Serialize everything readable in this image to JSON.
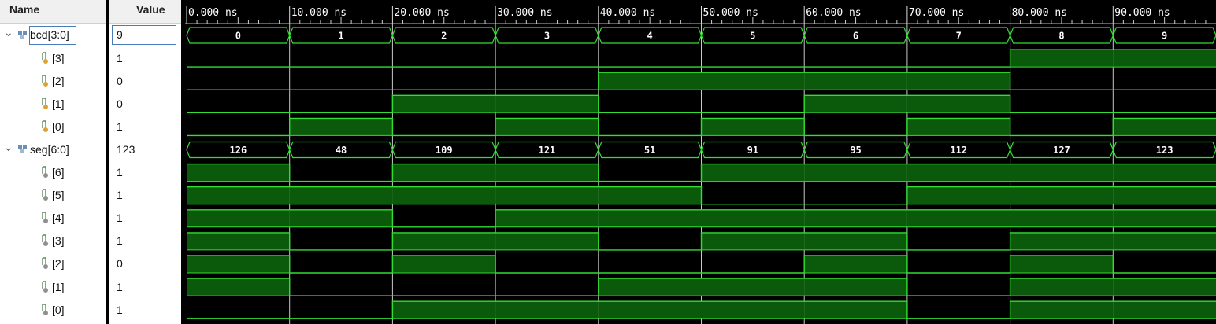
{
  "columns": {
    "name": "Name",
    "value": "Value"
  },
  "signals": [
    {
      "name": "bcd[3:0]",
      "value": "9",
      "kind": "bus",
      "expanded": true,
      "selected": true,
      "segments": [
        "0",
        "1",
        "2",
        "3",
        "4",
        "5",
        "6",
        "7",
        "8",
        "9"
      ]
    },
    {
      "name": "[3]",
      "value": "1",
      "kind": "bit",
      "color": "orange",
      "levels": [
        0,
        0,
        0,
        0,
        0,
        0,
        0,
        0,
        1,
        1
      ]
    },
    {
      "name": "[2]",
      "value": "0",
      "kind": "bit",
      "color": "orange",
      "levels": [
        0,
        0,
        0,
        0,
        1,
        1,
        1,
        1,
        0,
        0
      ]
    },
    {
      "name": "[1]",
      "value": "0",
      "kind": "bit",
      "color": "orange",
      "levels": [
        0,
        0,
        1,
        1,
        0,
        0,
        1,
        1,
        0,
        0
      ]
    },
    {
      "name": "[0]",
      "value": "1",
      "kind": "bit",
      "color": "orange",
      "levels": [
        0,
        1,
        0,
        1,
        0,
        1,
        0,
        1,
        0,
        1
      ]
    },
    {
      "name": "seg[6:0]",
      "value": "123",
      "kind": "bus",
      "expanded": true,
      "selected": false,
      "segments": [
        "126",
        "48",
        "109",
        "121",
        "51",
        "91",
        "95",
        "112",
        "127",
        "123"
      ]
    },
    {
      "name": "[6]",
      "value": "1",
      "kind": "bit",
      "color": "gray",
      "levels": [
        1,
        0,
        1,
        1,
        0,
        1,
        1,
        1,
        1,
        1
      ]
    },
    {
      "name": "[5]",
      "value": "1",
      "kind": "bit",
      "color": "gray",
      "levels": [
        1,
        1,
        1,
        1,
        1,
        0,
        0,
        1,
        1,
        1
      ]
    },
    {
      "name": "[4]",
      "value": "1",
      "kind": "bit",
      "color": "gray",
      "levels": [
        1,
        1,
        0,
        1,
        1,
        1,
        1,
        1,
        1,
        1
      ]
    },
    {
      "name": "[3]",
      "value": "1",
      "kind": "bit",
      "color": "gray",
      "levels": [
        1,
        0,
        1,
        1,
        0,
        1,
        1,
        0,
        1,
        1
      ]
    },
    {
      "name": "[2]",
      "value": "0",
      "kind": "bit",
      "color": "gray",
      "levels": [
        1,
        0,
        1,
        0,
        0,
        0,
        1,
        0,
        1,
        0
      ]
    },
    {
      "name": "[1]",
      "value": "1",
      "kind": "bit",
      "color": "gray",
      "levels": [
        1,
        0,
        0,
        0,
        1,
        1,
        1,
        0,
        1,
        1
      ]
    },
    {
      "name": "[0]",
      "value": "1",
      "kind": "bit",
      "color": "gray",
      "levels": [
        0,
        0,
        1,
        1,
        1,
        1,
        1,
        0,
        1,
        1
      ]
    }
  ],
  "timeline": {
    "ticks": [
      "0.000 ns",
      "10.000 ns",
      "20.000 ns",
      "30.000 ns",
      "40.000 ns",
      "50.000 ns",
      "60.000 ns",
      "70.000 ns",
      "80.000 ns",
      "90.000 ns"
    ]
  },
  "colors": {
    "wave_line": "#33dd33",
    "wave_fill": "#0b5a0b",
    "grid": "#c8c8c8",
    "background": "#000000",
    "bus_text": "#ffffff",
    "ruler_text": "#ffffff",
    "selection": "#4a7ab8"
  },
  "icons": {
    "bus": "bus-icon",
    "bit": "bit-icon",
    "expand": "chevron-down-icon"
  }
}
